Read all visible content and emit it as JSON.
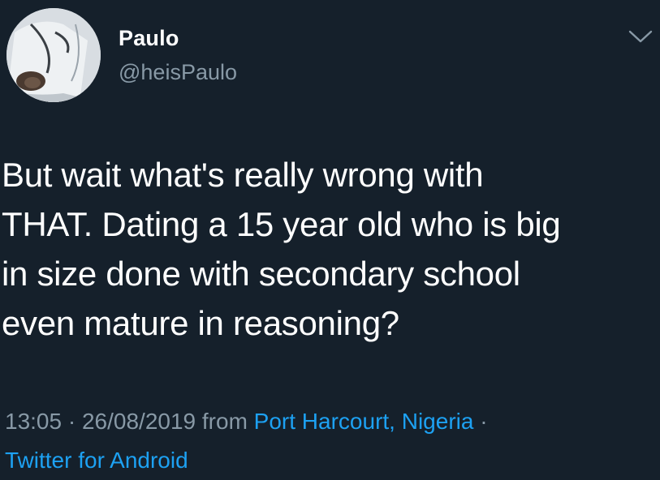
{
  "tweet": {
    "author": {
      "display_name": "Paulo",
      "handle": "@heisPaulo"
    },
    "text": "But wait what's really wrong with\nTHAT. Dating a 15 year old who is big\nin size done with secondary school\neven mature in reasoning?",
    "timestamp": "13:05",
    "separator": " · ",
    "date": "26/08/2019",
    "from_label": " from ",
    "location": "Port Harcourt, Nigeria",
    "separator2": " ·",
    "source": "Twitter for Android",
    "menu_icon": "chevron-down-icon"
  },
  "colors": {
    "background": "#15202b",
    "text_primary": "#ffffff",
    "text_secondary": "#8899a6",
    "link": "#1da1f2"
  }
}
